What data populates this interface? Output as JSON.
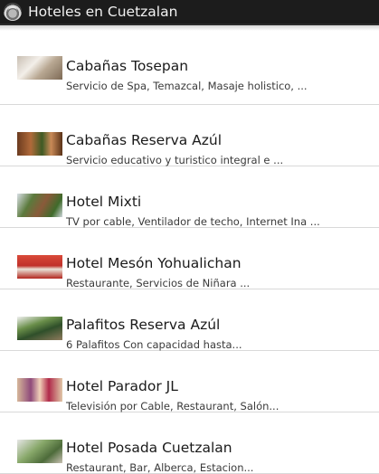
{
  "app": {
    "title": "Hoteles en Cuetzalan"
  },
  "hotels": [
    {
      "name": "Cabañas Tosepan",
      "description": "Servicio de Spa, Temazcal, Masaje holistico, ..."
    },
    {
      "name": "Cabañas Reserva Azúl",
      "description": "Servicio educativo y turistico integral e ..."
    },
    {
      "name": "Hotel Mixti",
      "description": "TV por cable, Ventilador de techo, Internet Ina ..."
    },
    {
      "name": "Hotel Mesón Yohualichan",
      "description": "Restaurante, Servicios de Niñara ..."
    },
    {
      "name": "Palafitos Reserva Azúl",
      "description": "6 Palafitos Con capacidad hasta..."
    },
    {
      "name": "Hotel Parador JL",
      "description": "Televisión por Cable, Restaurant, Salón..."
    },
    {
      "name": "Hotel Posada Cuetzalan",
      "description": "Restaurant, Bar, Alberca, Estacion..."
    }
  ]
}
